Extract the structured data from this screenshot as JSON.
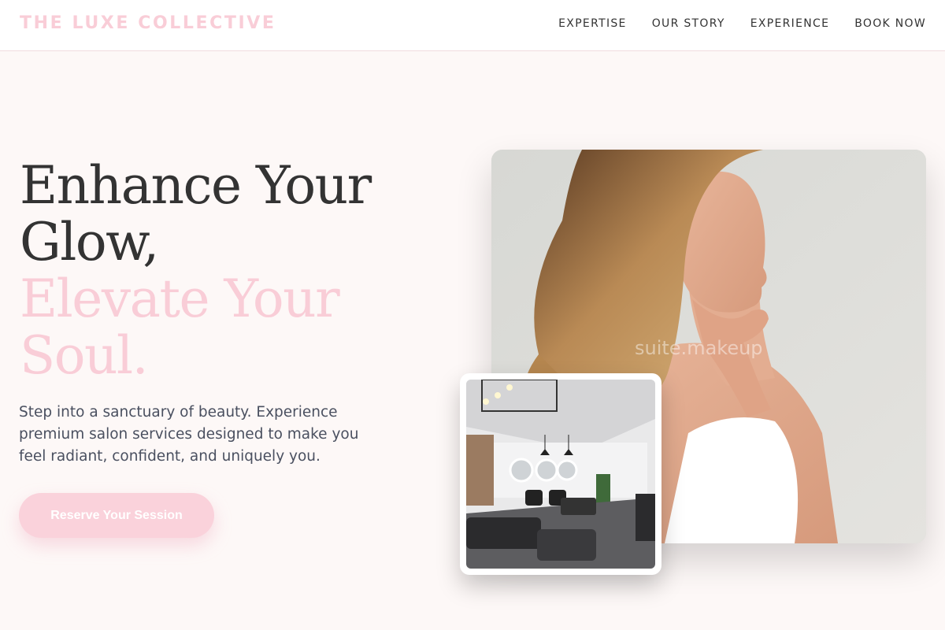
{
  "brand": {
    "name": "THE LUXE COLLECTIVE",
    "color": "#f9cdd7"
  },
  "nav": {
    "items": [
      {
        "label": "EXPERTISE"
      },
      {
        "label": "OUR STORY"
      },
      {
        "label": "EXPERIENCE"
      },
      {
        "label": "BOOK NOW"
      }
    ]
  },
  "hero": {
    "headline_line1": "Enhance Your",
    "headline_line2": "Glow,",
    "headline_accent_line1": "Elevate Your",
    "headline_accent_line2": "Soul.",
    "subtitle": "Step into a sanctuary of beauty. Experience premium salon services designed to make you feel radiant, confident, and uniquely you.",
    "cta_label": "Reserve Your Session"
  },
  "images": {
    "main_photo_watermark": "suite.makeup"
  },
  "colors": {
    "accent_pink": "#f9cdd7",
    "cta_pink": "#fad2db",
    "background": "#fdf8f7",
    "text_dark": "#333333"
  }
}
